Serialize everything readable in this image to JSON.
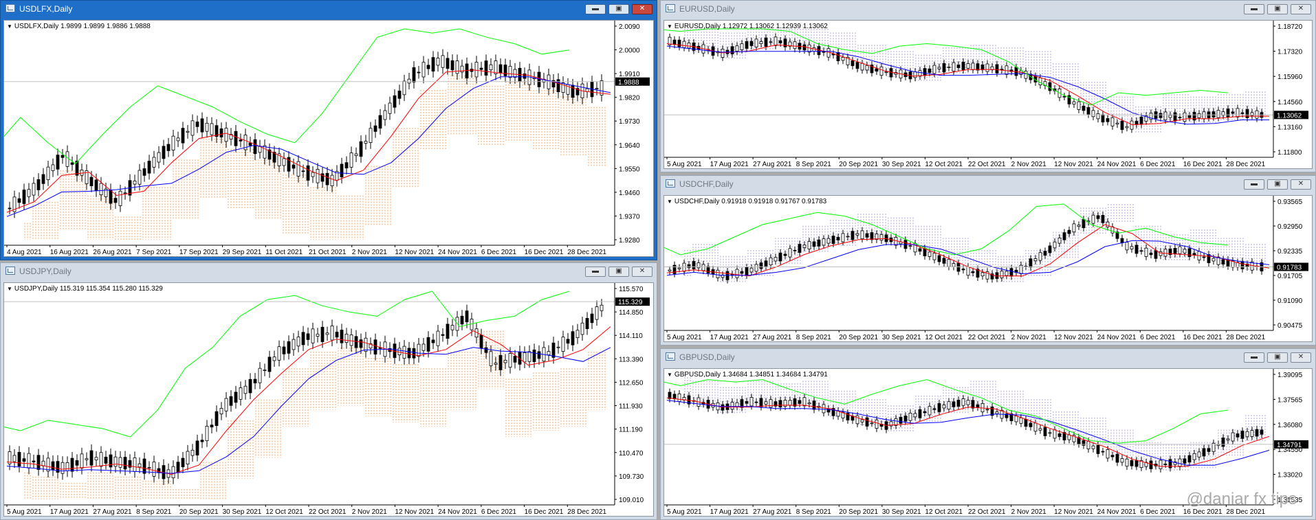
{
  "windows": [
    {
      "key": "usdlfx",
      "state": "active",
      "title": "USDLFX,Daily",
      "symbol_info": "USDLFX,Daily  1.9899 1.9899 1.9886 1.9888",
      "price_tag": "1.9888",
      "y_ticks": [
        "2.0090",
        "2.0000",
        "1.9910",
        "1.9820",
        "1.9730",
        "1.9640",
        "1.9550",
        "1.9460",
        "1.9370",
        "1.9280"
      ],
      "x_ticks": [
        "4 Aug 2021",
        "16 Aug 2021",
        "26 Aug 2021",
        "7 Sep 2021",
        "17 Sep 2021",
        "29 Sep 2021",
        "11 Oct 2021",
        "21 Oct 2021",
        "2 Nov 2021",
        "12 Nov 2021",
        "24 Nov 2021",
        "6 Dec 2021",
        "16 Dec 2021",
        "28 Dec 2021"
      ],
      "last_close": 1.9888,
      "buttons": [
        "minimize",
        "maximize",
        "close"
      ]
    },
    {
      "key": "usdjpy",
      "state": "inactive",
      "title": "USDJPY,Daily",
      "symbol_info": "USDJPY,Daily  115.319 115.354 115.280 115.329",
      "price_tag": "115.329",
      "y_ticks": [
        "115.570",
        "114.850",
        "114.110",
        "113.390",
        "112.650",
        "111.930",
        "111.190",
        "110.470",
        "109.730",
        "109.010"
      ],
      "x_ticks": [
        "5 Aug 2021",
        "17 Aug 2021",
        "27 Aug 2021",
        "8 Sep 2021",
        "20 Sep 2021",
        "30 Sep 2021",
        "12 Oct 2021",
        "22 Oct 2021",
        "2 Nov 2021",
        "12 Nov 2021",
        "24 Nov 2021",
        "6 Dec 2021",
        "16 Dec 2021",
        "28 Dec 2021"
      ],
      "last_close": 115.329,
      "buttons": [
        "minimize",
        "maximize",
        "close"
      ]
    },
    {
      "key": "eurusd",
      "state": "inactive",
      "title": "EURUSD,Daily",
      "symbol_info": "EURUSD,Daily  1.12972 1.13062 1.12939 1.13062",
      "price_tag": "1.13062",
      "y_ticks": [
        "1.18720",
        "1.17320",
        "1.15960",
        "1.14560",
        "1.13160",
        "1.11800"
      ],
      "x_ticks": [
        "5 Aug 2021",
        "17 Aug 2021",
        "27 Aug 2021",
        "8 Sep 2021",
        "20 Sep 2021",
        "30 Sep 2021",
        "12 Oct 2021",
        "22 Oct 2021",
        "2 Nov 2021",
        "12 Nov 2021",
        "24 Nov 2021",
        "6 Dec 2021",
        "16 Dec 2021",
        "28 Dec 2021"
      ],
      "last_close": 1.13062,
      "buttons": [
        "minimize",
        "maximize",
        "close"
      ]
    },
    {
      "key": "usdchf",
      "state": "inactive",
      "title": "USDCHF,Daily",
      "symbol_info": "USDCHF,Daily  0.91918 0.91918 0.91767 0.91783",
      "price_tag": "0.91783",
      "y_ticks": [
        "0.93565",
        "0.92950",
        "0.92335",
        "0.91705",
        "0.91090",
        "0.90475"
      ],
      "x_ticks": [
        "5 Aug 2021",
        "17 Aug 2021",
        "27 Aug 2021",
        "8 Sep 2021",
        "20 Sep 2021",
        "30 Sep 2021",
        "12 Oct 2021",
        "22 Oct 2021",
        "2 Nov 2021",
        "12 Nov 2021",
        "24 Nov 2021",
        "6 Dec 2021",
        "16 Dec 2021",
        "28 Dec 2021"
      ],
      "last_close": 0.91783,
      "buttons": [
        "minimize",
        "maximize",
        "close"
      ]
    },
    {
      "key": "gbpusd",
      "state": "inactive",
      "title": "GBPUSD,Daily",
      "symbol_info": "GBPUSD,Daily  1.34684 1.34851 1.34684 1.34791",
      "price_tag": "1.34791",
      "y_ticks": [
        "1.39095",
        "1.37565",
        "1.36080",
        "1.34550",
        "1.33020",
        "1.31535"
      ],
      "x_ticks": [
        "5 Aug 2021",
        "17 Aug 2021",
        "27 Aug 2021",
        "8 Sep 2021",
        "20 Sep 2021",
        "30 Sep 2021",
        "12 Oct 2021",
        "22 Oct 2021",
        "2 Nov 2021",
        "12 Nov 2021",
        "24 Nov 2021",
        "6 Dec 2021",
        "16 Dec 2021",
        "28 Dec 2021"
      ],
      "last_close": 1.34791,
      "buttons": [
        "minimize",
        "maximize",
        "close"
      ]
    }
  ],
  "watermark": "@daniar fx tips",
  "colors": {
    "active_title": "#1f6fc8",
    "inactive_title": "#d2dbe6",
    "candle_up": "#ffffff",
    "candle_down": "#000000",
    "tenkan": "#ff0000",
    "kijun": "#0000ff",
    "chikou": "#00ff00",
    "kumo_bull": "#f4a460",
    "kumo_bear": "#b0a0d8"
  }
}
